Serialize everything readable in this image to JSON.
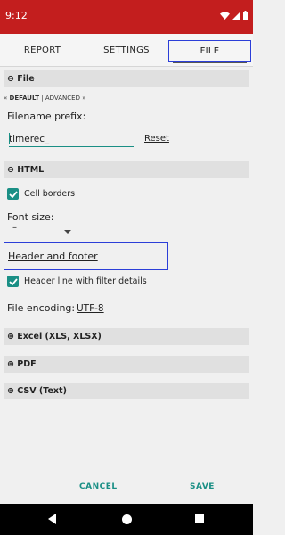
{
  "status_bar": {
    "time": "9:12",
    "color": "#c31e1e"
  },
  "tabs": [
    {
      "label": "REPORT"
    },
    {
      "label": "SETTINGS"
    },
    {
      "label": "FILE"
    }
  ],
  "file_section": {
    "header": "⊖ File",
    "mode_default": "DEFAULT",
    "mode_rest": " | ADVANCED »",
    "mode_prefix": "« ",
    "prefix_label": "Filename prefix:",
    "prefix_value": "timerec_",
    "reset_label": "Reset"
  },
  "html_section": {
    "header": "⊖ HTML",
    "cell_borders_label": "Cell borders",
    "font_size_label": "Font size:",
    "font_size_value": "–",
    "header_footer_label": "Header and footer",
    "header_line_label": "Header line with filter details",
    "encoding_label": "File encoding:",
    "encoding_value": "UTF-8"
  },
  "excel_header": "⊕ Excel (XLS, XLSX)",
  "pdf_header": "⊕ PDF",
  "csv_header": "⊕ CSV (Text)",
  "footer": {
    "cancel_label": "CANCEL",
    "save_label": "SAVE"
  },
  "accent_color": "#1a8f85",
  "highlight_color": "#2b3ed8"
}
